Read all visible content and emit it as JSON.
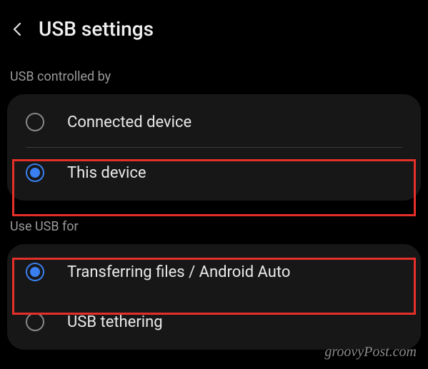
{
  "header": {
    "title": "USB settings"
  },
  "sections": {
    "controlled_by": {
      "label": "USB controlled by",
      "options": [
        {
          "label": "Connected device",
          "selected": false
        },
        {
          "label": "This device",
          "selected": true
        }
      ]
    },
    "use_for": {
      "label": "Use USB for",
      "options": [
        {
          "label": "Transferring files / Android Auto",
          "selected": true
        },
        {
          "label": "USB tethering",
          "selected": false
        }
      ]
    }
  },
  "watermark": "groovyPost.com"
}
